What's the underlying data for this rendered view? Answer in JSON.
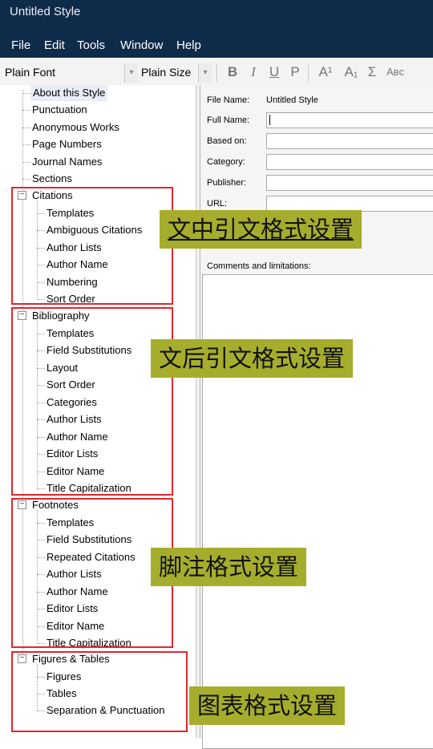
{
  "window": {
    "title": "Untitled Style"
  },
  "menu": [
    "File",
    "Edit",
    "Tools",
    "Window",
    "Help"
  ],
  "toolbar": {
    "font": "Plain Font",
    "size": "Plain Size",
    "bold": "B",
    "italic": "I",
    "underline": "U",
    "plain": "P",
    "superscript": "A¹",
    "subscript": "A₁",
    "symbol": "Σ",
    "smallcaps": "Aʙᴄ"
  },
  "tree": {
    "about": "About this Style",
    "punctuation": "Punctuation",
    "anonymous": "Anonymous Works",
    "page_numbers": "Page Numbers",
    "journal_names": "Journal Names",
    "sections": "Sections",
    "citations": {
      "label": "Citations",
      "items": [
        "Templates",
        "Ambiguous Citations",
        "Author Lists",
        "Author Name",
        "Numbering",
        "Sort Order"
      ]
    },
    "bibliography": {
      "label": "Bibliography",
      "items": [
        "Templates",
        "Field Substitutions",
        "Layout",
        "Sort Order",
        "Categories",
        "Author Lists",
        "Author Name",
        "Editor Lists",
        "Editor Name",
        "Title Capitalization"
      ]
    },
    "footnotes": {
      "label": "Footnotes",
      "items": [
        "Templates",
        "Field Substitutions",
        "Repeated Citations",
        "Author Lists",
        "Author Name",
        "Editor Lists",
        "Editor Name",
        "Title Capitalization"
      ]
    },
    "figures": {
      "label": "Figures & Tables",
      "items": [
        "Figures",
        "Tables",
        "Separation & Punctuation"
      ]
    }
  },
  "panel": {
    "file_name_label": "File Name:",
    "file_name_value": "Untitled Style",
    "full_name_label": "Full Name:",
    "based_on_label": "Based on:",
    "category_label": "Category:",
    "publisher_label": "Publisher:",
    "url_label": "URL:",
    "comments_label": "Comments and limitations:"
  },
  "annotations": {
    "citations": "文中引文格式设置",
    "bibliography": "文后引文格式设置",
    "footnotes": "脚注格式设置",
    "figures": "图表格式设置"
  },
  "colors": {
    "titlebar": "#0f2b4a",
    "highlight_box": "#e0272f",
    "annotation_bg": "#a6ad2c"
  }
}
